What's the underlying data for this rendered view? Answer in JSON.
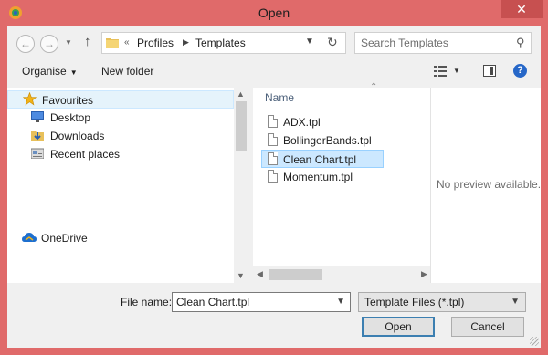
{
  "window": {
    "title": "Open",
    "close_glyph": "✕"
  },
  "address_bar": {
    "overflow_glyph": "«",
    "breadcrumbs": [
      "Profiles",
      "Templates"
    ]
  },
  "search": {
    "placeholder": "Search Templates"
  },
  "toolbar": {
    "organise_label": "Organise",
    "new_folder_label": "New folder",
    "help_glyph": "?"
  },
  "nav_pane": {
    "items": [
      {
        "label": "Favourites",
        "icon": "star-icon"
      },
      {
        "label": "Desktop",
        "icon": "desktop-icon"
      },
      {
        "label": "Downloads",
        "icon": "downloads-icon"
      },
      {
        "label": "Recent places",
        "icon": "recent-places-icon"
      },
      {
        "label": "OneDrive",
        "icon": "onedrive-icon"
      }
    ]
  },
  "file_list": {
    "column_header": "Name",
    "files": [
      "ADX.tpl",
      "BollingerBands.tpl",
      "Clean Chart.tpl",
      "Momentum.tpl"
    ],
    "selected_index": 2
  },
  "preview": {
    "message": "No preview available."
  },
  "footer": {
    "file_name_label": "File name:",
    "file_name_value": "Clean Chart.tpl",
    "file_type_value": "Template Files (*.tpl)",
    "open_label": "Open",
    "cancel_label": "Cancel"
  },
  "colors": {
    "frame": "#e06a6a",
    "selection": "#cce8ff",
    "accent": "#3c7fb1"
  }
}
